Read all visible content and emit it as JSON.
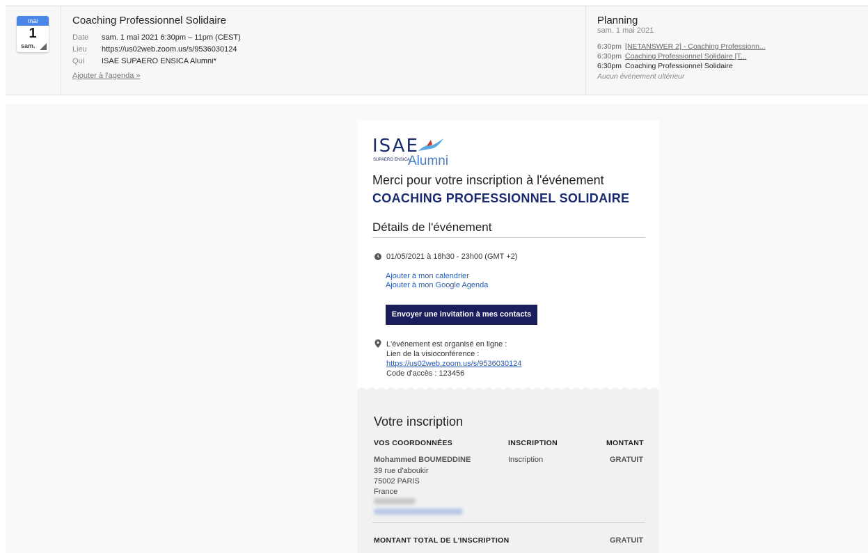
{
  "invite": {
    "calendar": {
      "month": "mai",
      "day": "1",
      "weekday": "sam."
    },
    "title": "Coaching Professionnel Solidaire",
    "date_label": "Date",
    "date_value": "sam. 1 mai 2021 6:30pm – 11pm (CEST)",
    "place_label": "Lieu",
    "place_value": "https://us02web.zoom.us/s/9536030124",
    "who_label": "Qui",
    "who_value": "ISAE SUPAERO ENSICA Alumni*",
    "add_to_agenda": "Ajouter à l'agenda »"
  },
  "planning": {
    "title": "Planning",
    "date": "sam. 1 mai 2021",
    "items": [
      {
        "time": "6:30pm",
        "label": "[NETANSWER 2] - Coaching Professionn..."
      },
      {
        "time": "6:30pm",
        "label": "Coaching Professionnel Solidaire [T..."
      },
      {
        "time": "6:30pm",
        "label": "Coaching Professionnel Solidaire"
      }
    ],
    "none": "Aucun événement ultérieur"
  },
  "email": {
    "logo": {
      "isae": "ISAE",
      "sub": "SUPAERO ENSICA",
      "alumni": "Alumni"
    },
    "thanks": "Merci pour votre inscription à l'événement",
    "event_name": "COACHING PROFESSIONNEL SOLIDAIRE",
    "details_title": "Détails de l'événement",
    "datetime": "01/05/2021 à 18h30 - 23h00 (GMT +2)",
    "add_calendar": "Ajouter à mon calendrier",
    "add_google": "Ajouter à mon Google Agenda",
    "invite_button": "Envoyer une invitation à mes contacts",
    "online_text": "L'événement est organisé en ligne :",
    "visio_label": "Lien de la visioconférence :",
    "zoom_link": "https://us02web.zoom.us/s/9536030124",
    "access_code": "Code d'accès : 123456",
    "registration": {
      "title": "Votre inscription",
      "col_contact": "VOS COORDONNÉES",
      "col_registration": "INSCRIPTION",
      "col_amount": "MONTANT",
      "name": "Mohammed BOUMEDDINE",
      "address_line1": "39 rue d'aboukir",
      "address_line2": "75002 PARIS",
      "address_line3": "France",
      "registration_type": "Inscription",
      "amount": "GRATUIT",
      "total_label": "MONTANT TOTAL DE L'INSCRIPTION",
      "total_value": "GRATUIT"
    }
  },
  "colors": {
    "navy": "#1a2a6c",
    "button": "#1a1f5c",
    "link": "#2a5db0",
    "calendar_blue": "#4a86e8"
  }
}
